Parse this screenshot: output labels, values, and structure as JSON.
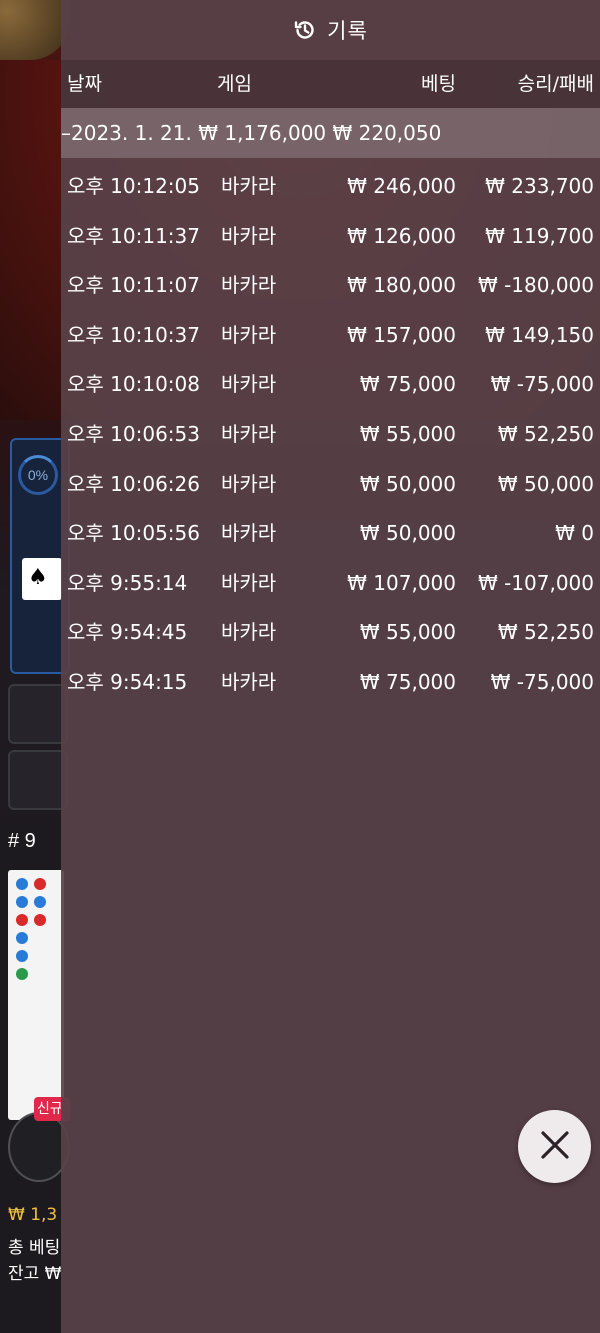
{
  "header": {
    "title": "기록",
    "icon": "history-icon"
  },
  "columns": {
    "time": "날짜",
    "game": "게임",
    "bet": "베팅",
    "result": "승리/패배"
  },
  "date_group": {
    "date": "–2023. 1. 21.",
    "total_bet": "₩ 1,176,000",
    "total_result": "₩ 220,050"
  },
  "records": [
    {
      "time": "오후 10:12:05",
      "game": "바카라",
      "bet": "₩ 246,000",
      "result": "₩ 233,700"
    },
    {
      "time": "오후 10:11:37",
      "game": "바카라",
      "bet": "₩ 126,000",
      "result": "₩ 119,700"
    },
    {
      "time": "오후 10:11:07",
      "game": "바카라",
      "bet": "₩ 180,000",
      "result": "₩ -180,000"
    },
    {
      "time": "오후 10:10:37",
      "game": "바카라",
      "bet": "₩ 157,000",
      "result": "₩ 149,150"
    },
    {
      "time": "오후 10:10:08",
      "game": "바카라",
      "bet": "₩ 75,000",
      "result": "₩ -75,000"
    },
    {
      "time": "오후 10:06:53",
      "game": "바카라",
      "bet": "₩ 55,000",
      "result": "₩ 52,250"
    },
    {
      "time": "오후 10:06:26",
      "game": "바카라",
      "bet": "₩ 50,000",
      "result": "₩ 50,000"
    },
    {
      "time": "오후 10:05:56",
      "game": "바카라",
      "bet": "₩ 50,000",
      "result": "₩ 0"
    },
    {
      "time": "오후 9:55:14",
      "game": "바카라",
      "bet": "₩ 107,000",
      "result": "₩ -107,000"
    },
    {
      "time": "오후 9:54:45",
      "game": "바카라",
      "bet": "₩ 55,000",
      "result": "₩ 52,250"
    },
    {
      "time": "오후 9:54:15",
      "game": "바카라",
      "bet": "₩ 75,000",
      "result": "₩ -75,000"
    }
  ],
  "background": {
    "progress_percent": "0%",
    "round_label": "# 9",
    "new_tag": "신규",
    "footer_balance": "₩ 1,3",
    "footer_total_bet": "총 베팅",
    "footer_remaining": "잔고 ₩"
  },
  "colors": {
    "overlay": "#584248",
    "accent_gold": "#f0c040",
    "close_button": "#efeaec"
  },
  "close_button": {
    "icon": "close-icon"
  }
}
